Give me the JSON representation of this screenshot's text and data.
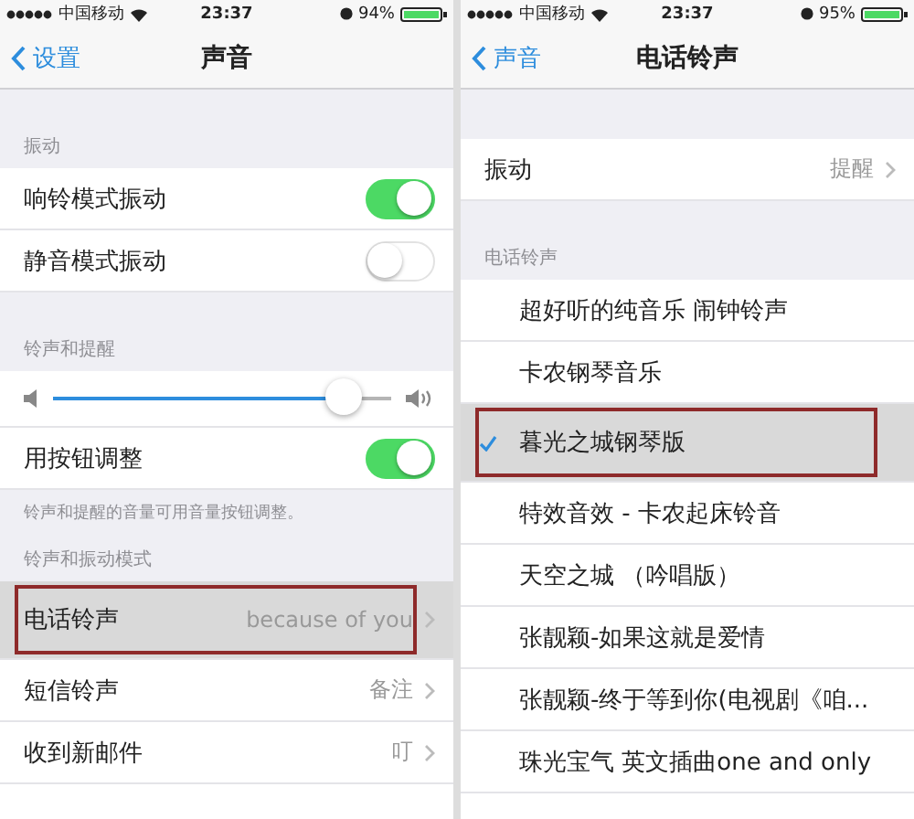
{
  "screens": [
    {
      "status_bar": {
        "carrier": "中国移动",
        "time": "23:37",
        "battery": "94%"
      },
      "nav": {
        "back": "设置",
        "title": "声音"
      },
      "sections": [
        {
          "header": "振动",
          "rows": [
            {
              "kind": "toggle",
              "label": "响铃模式振动",
              "on": true
            },
            {
              "kind": "toggle",
              "label": "静音模式振动",
              "on": false
            }
          ]
        },
        {
          "header": "铃声和提醒",
          "rows": [
            {
              "kind": "slider",
              "level": 0.86
            },
            {
              "kind": "toggle",
              "label": "用按钮调整",
              "on": true
            }
          ],
          "footer": "铃声和提醒的音量可用音量按钮调整。"
        },
        {
          "header": "铃声和振动模式",
          "rows": [
            {
              "kind": "disclosure",
              "label": "电话铃声",
              "value": "because of you",
              "highlighted": true
            },
            {
              "kind": "disclosure",
              "label": "短信铃声",
              "value": "备注",
              "highlighted": false
            },
            {
              "kind": "disclosure",
              "label": "收到新邮件",
              "value": "叮",
              "highlighted": false
            }
          ]
        }
      ]
    },
    {
      "status_bar": {
        "carrier": "中国移动",
        "time": "23:37",
        "battery": "95%"
      },
      "nav": {
        "back": "声音",
        "title": "电话铃声"
      },
      "sections": [
        {
          "rows": [
            {
              "kind": "disclosure",
              "label": "振动",
              "value": "提醒",
              "highlighted": false
            }
          ]
        },
        {
          "header": "电话铃声",
          "rows": [
            {
              "kind": "choice",
              "label": "超好听的纯音乐 闹钟铃声",
              "checked": false,
              "highlighted": false
            },
            {
              "kind": "choice",
              "label": "卡农钢琴音乐",
              "checked": false,
              "highlighted": false
            },
            {
              "kind": "choice",
              "label": "暮光之城钢琴版",
              "checked": true,
              "highlighted": true
            },
            {
              "kind": "choice",
              "label": "特效音效 - 卡农起床铃音",
              "checked": false,
              "highlighted": false
            },
            {
              "kind": "choice",
              "label": "天空之城 （吟唱版）",
              "checked": false,
              "highlighted": false
            },
            {
              "kind": "choice",
              "label": "张靓颖-如果这就是爱情",
              "checked": false,
              "highlighted": false
            },
            {
              "kind": "choice",
              "label": "张靓颖-终于等到你(电视剧《咱...",
              "checked": false,
              "highlighted": false
            },
            {
              "kind": "choice",
              "label": "珠光宝气 英文插曲one and only",
              "checked": false,
              "highlighted": false
            }
          ]
        }
      ]
    }
  ]
}
